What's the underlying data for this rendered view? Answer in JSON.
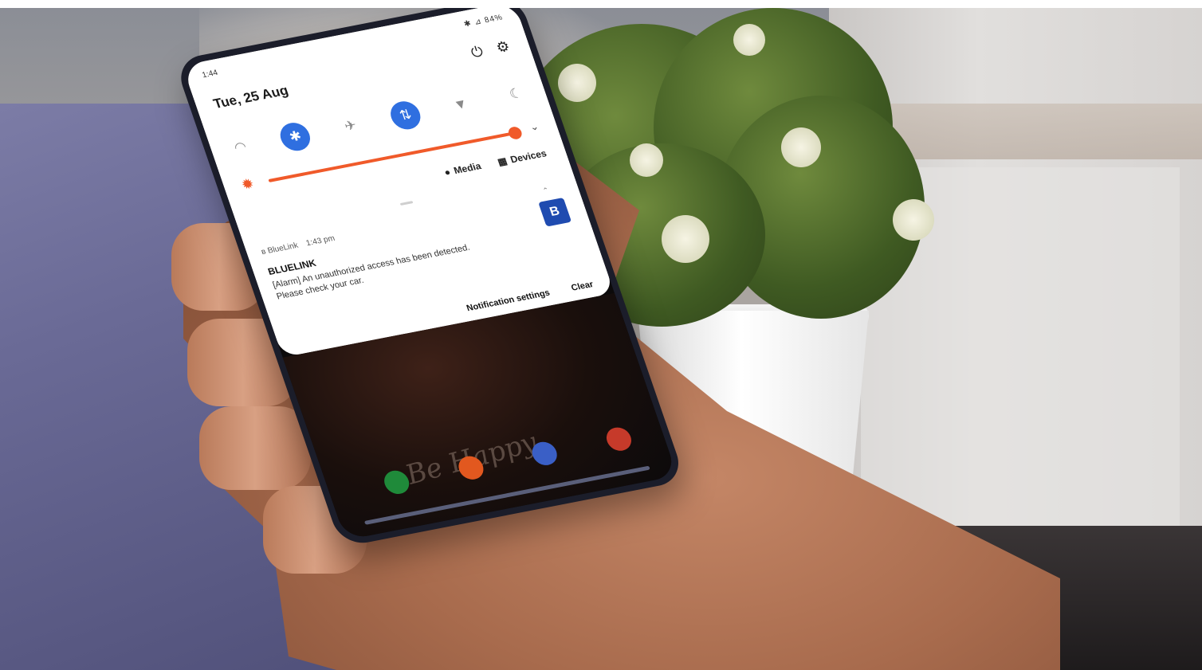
{
  "status_bar": {
    "time": "1:44",
    "indicators": "✱ ⊿ 84%"
  },
  "quick_panel": {
    "date": "Tue, 25 Aug",
    "power_icon": "power-icon",
    "settings_icon": "gear-icon",
    "tiles": [
      {
        "icon": "wifi-icon",
        "glyph": "◠",
        "on": false
      },
      {
        "icon": "bluetooth-icon",
        "glyph": "✱",
        "on": true
      },
      {
        "icon": "airplane-icon",
        "glyph": "✈",
        "on": false
      },
      {
        "icon": "mobile-data-icon",
        "glyph": "⇅",
        "on": true
      },
      {
        "icon": "flashlight-icon",
        "glyph": "▼",
        "on": false
      },
      {
        "icon": "night-mode-icon",
        "glyph": "☾",
        "on": false
      }
    ],
    "brightness_level": 0.95,
    "accent_color": "#f05a2a",
    "tile_on_color": "#2f6fe0",
    "media_label": "Media",
    "devices_label": "Devices"
  },
  "notification": {
    "app_name": "BlueLink",
    "time": "1:43 pm",
    "title": "BLUELINK",
    "body": "[Alarm] An unauthorized access has been detected. Please check your car.",
    "logo_glyph": "B",
    "settings_label": "Notification settings",
    "clear_label": "Clear"
  },
  "wallpaper": {
    "text": "Be Happy"
  }
}
